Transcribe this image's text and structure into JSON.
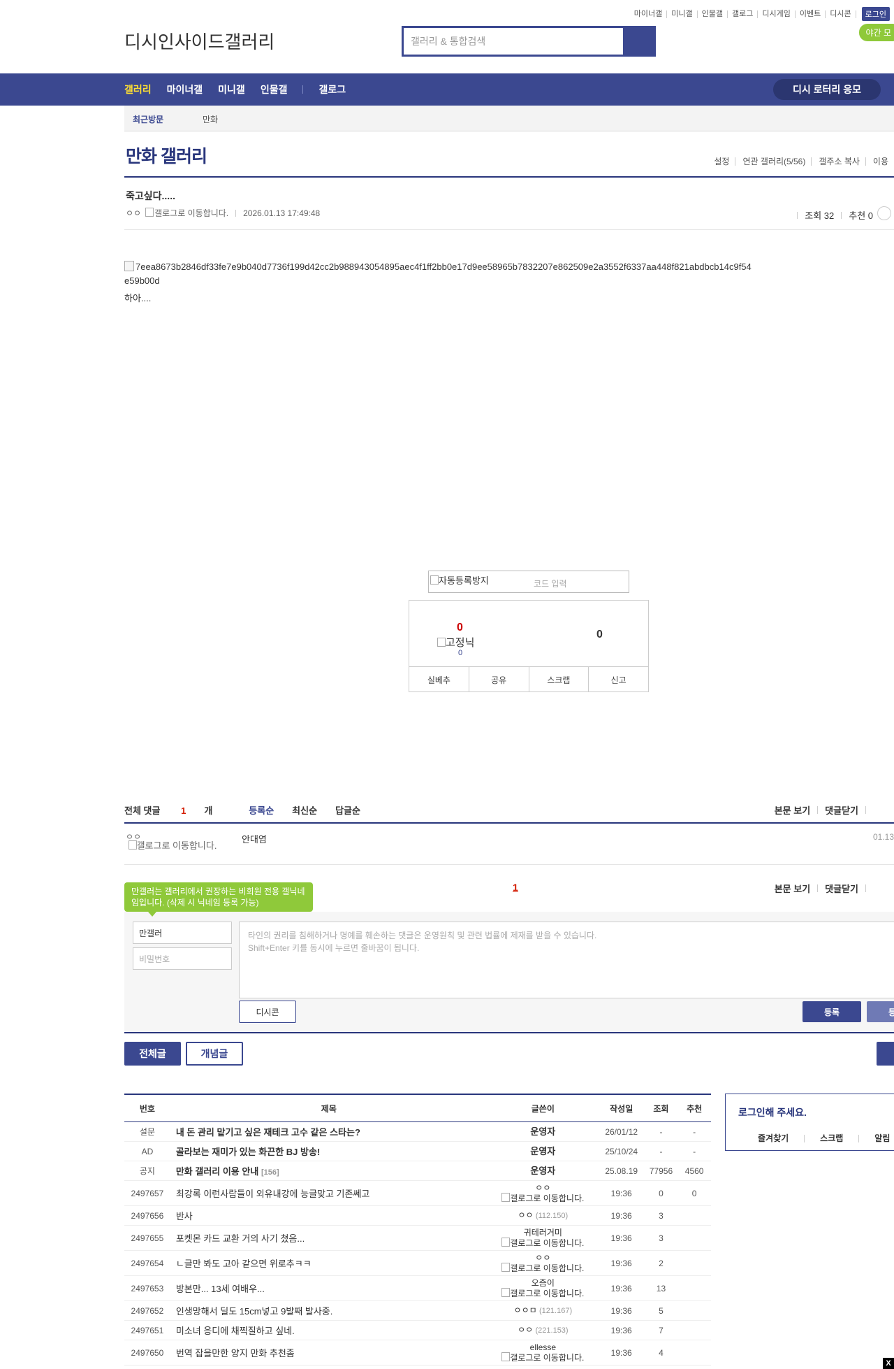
{
  "util_menu": [
    "마이너갤",
    "미니갤",
    "인물갤",
    "갤로그",
    "디시게임",
    "이벤트",
    "디시콘"
  ],
  "login_label": "로그인",
  "night_label": "야간 모",
  "logo_text": "디시인사이드",
  "logo_sub": "갤러리",
  "search_placeholder": "갤러리 & 통합검색",
  "nav": {
    "items": [
      "갤러리",
      "마이너갤",
      "미니갤",
      "인물갤"
    ],
    "gallog": "갤로그",
    "lotto": "디시 로터리 응모"
  },
  "recent": {
    "label": "최근방문",
    "value": "만화"
  },
  "gallery_title": "만화 갤러리",
  "gallery_tools": [
    "설정",
    "연관 갤러리(5/56)",
    "갤주소 복사",
    "이용"
  ],
  "post": {
    "title": "죽고싶다.....",
    "author": "ㅇㅇ",
    "gallog_alt": "갤로그로 이동합니다.",
    "date": "2026.01.13 17:49:48",
    "views_label": "조회 32",
    "recommend_label": "추천 0",
    "image_alt": "7eea8673b2846df33fe7e9b040d7736f199d42cc2b988943054895aec4f1ff2bb0e17d9ee58965b7832207e862509e2a3552f6337aa448f821abdbcb14c9f54e59b00d",
    "body": "하아...."
  },
  "captcha": {
    "img_alt": "자동등록방지",
    "placeholder": "코드 입력"
  },
  "vote": {
    "up": "0",
    "fixed_nick": "고정닉",
    "up_sub": "0",
    "down": "0",
    "buttons": [
      "실베추",
      "공유",
      "스크랩",
      "신고"
    ]
  },
  "comments": {
    "total_label": "전체 댓글",
    "count": "1",
    "unit": "개",
    "sorts": [
      "등록순",
      "최신순",
      "답글순"
    ],
    "right_links": [
      "본문 보기",
      "댓글닫기"
    ],
    "item": {
      "nick": "ㅇㅇ",
      "gallog_alt": "갤로그로 이동합니다.",
      "text": "안대염",
      "date": "01.13"
    },
    "page": "1"
  },
  "write": {
    "tip": "만갤러는 갤러리에서 권장하는 비회원 전용 갤닉네임입니다. (삭제 시 닉네임 등록 가능)",
    "nick_value": "만갤러",
    "password_placeholder": "비밀번호",
    "textarea_line1": "타인의 권리를 침해하거나 명예를 훼손하는 댓글은 운영원칙 및 관련 법률에 제재를 받을 수 있습니다.",
    "textarea_line2": "Shift+Enter 키를 동시에 누르면 줄바꿈이 됩니다.",
    "dccon": "디시콘",
    "submit": "등록",
    "submit2": "등록"
  },
  "list_tabs": [
    "전체글",
    "개념글"
  ],
  "table": {
    "headers": [
      "번호",
      "제목",
      "글쓴이",
      "작성일",
      "조회",
      "추천"
    ],
    "rows": [
      {
        "num": "설문",
        "title": "내 돈 관리 맡기고 싶은 재테크 고수 같은 스타는?",
        "reply": "",
        "writer": "운영자",
        "writer2": "",
        "ip": "",
        "date": "26/01/12",
        "views": "-",
        "rec": "-",
        "notice": true
      },
      {
        "num": "AD",
        "title": "골라보는 재미가 있는 화끈한 BJ 방송!",
        "reply": "",
        "writer": "운영자",
        "writer2": "",
        "ip": "",
        "date": "25/10/24",
        "views": "-",
        "rec": "-",
        "notice": true
      },
      {
        "num": "공지",
        "title": "만화 갤러리 이용 안내",
        "reply": "[156]",
        "writer": "운영자",
        "writer2": "",
        "ip": "",
        "date": "25.08.19",
        "views": "77956",
        "rec": "4560",
        "notice": true
      },
      {
        "num": "2497657",
        "title": "최강록 이런사람들이 외유내강에 능글맞고 기존쎄고",
        "reply": "",
        "writer": "ㅇㅇ",
        "writer2": "갤로그로 이동합니다.",
        "ip": "",
        "date": "19:36",
        "views": "0",
        "rec": "0",
        "notice": false
      },
      {
        "num": "2497656",
        "title": "반사",
        "reply": "",
        "writer": "ㅇㅇ",
        "writer2": "",
        "ip": "(112.150)",
        "date": "19:36",
        "views": "3",
        "rec": "",
        "notice": false
      },
      {
        "num": "2497655",
        "title": "포켓몬 카드 교환 거의 사기 쳤음...",
        "reply": "",
        "writer": "귀테러거미",
        "writer2": "갤로그로 이동합니다.",
        "ip": "",
        "date": "19:36",
        "views": "3",
        "rec": "",
        "notice": false
      },
      {
        "num": "2497654",
        "title": "ㄴ글만 봐도 고아 같으면 위로추ㅋㅋ",
        "reply": "",
        "writer": "ㅇㅇ",
        "writer2": "갤로그로 이동합니다.",
        "ip": "",
        "date": "19:36",
        "views": "2",
        "rec": "",
        "notice": false
      },
      {
        "num": "2497653",
        "title": "방본만... 13세 여배우...",
        "reply": "",
        "writer": "오즘이",
        "writer2": "갤로그로 이동합니다.",
        "ip": "",
        "date": "19:36",
        "views": "13",
        "rec": "",
        "notice": false
      },
      {
        "num": "2497652",
        "title": "인생망해서 딜도 15cm넣고 9발째 발사중.",
        "reply": "",
        "writer": "ㅇㅇㅁ",
        "writer2": "",
        "ip": "(121.167)",
        "date": "19:36",
        "views": "5",
        "rec": "",
        "notice": false
      },
      {
        "num": "2497651",
        "title": "미소녀 응디에 채찍질하고 싶네.",
        "reply": "",
        "writer": "ㅇㅇ",
        "writer2": "",
        "ip": "(221.153)",
        "date": "19:36",
        "views": "7",
        "rec": "",
        "notice": false
      },
      {
        "num": "2497650",
        "title": "번역 잡을만한 양지 만화 추천좀",
        "reply": "",
        "writer": "ellesse",
        "writer2": "갤로그로 이동합니다.",
        "ip": "",
        "date": "19:36",
        "views": "4",
        "rec": "",
        "notice": false
      }
    ]
  },
  "login_box": {
    "title": "로그인해 주세요.",
    "links": [
      "즐겨찾기",
      "스크랩",
      "알림"
    ]
  },
  "close_label": "X",
  "colors": {
    "brand": "#3b4890",
    "brand_dark": "#29367c",
    "accent_yellow": "#ffdf32",
    "green": "#8fc93a",
    "red": "#d31900"
  }
}
